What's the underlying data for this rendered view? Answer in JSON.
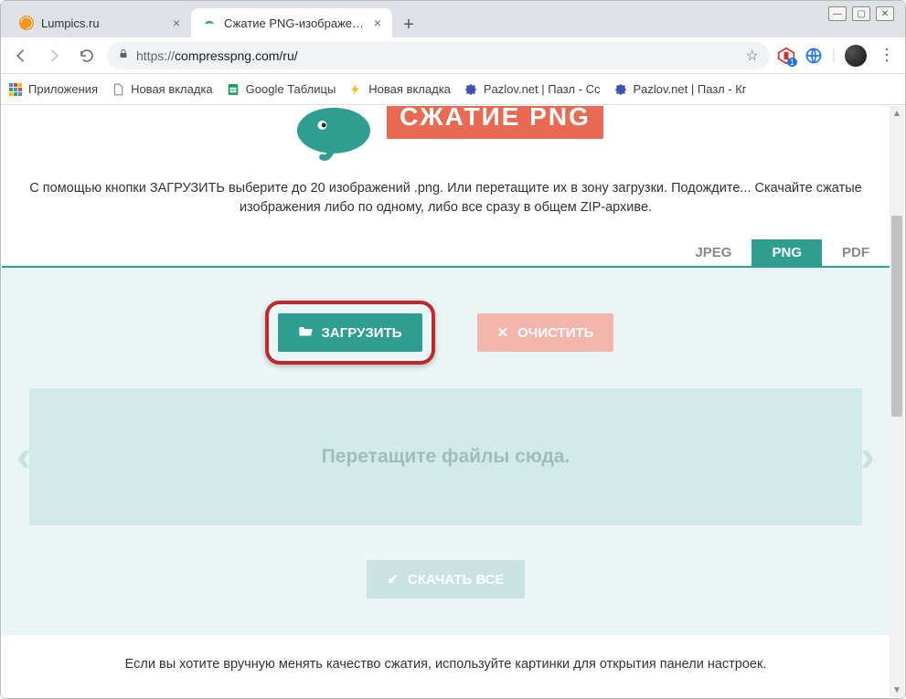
{
  "window_controls": {
    "min": "—",
    "max": "▢",
    "close": "✕"
  },
  "tabs": [
    {
      "title": "Lumpics.ru",
      "active": false,
      "favicon_color": "#f7931e"
    },
    {
      "title": "Сжатие PNG-изображений онл",
      "active": true,
      "favicon_color": "#2f9e91"
    }
  ],
  "address": {
    "protocol": "https://",
    "rest": "compresspng.com/ru/"
  },
  "ext_badge": "1",
  "bookmarks": [
    {
      "icon": "apps",
      "label": "Приложения"
    },
    {
      "icon": "doc",
      "label": "Новая вкладка"
    },
    {
      "icon": "sheets",
      "label": "Google Таблицы"
    },
    {
      "icon": "bolt",
      "label": "Новая вкладка"
    },
    {
      "icon": "puzzle",
      "label": "Pazlov.net | Пазл - Сс"
    },
    {
      "icon": "puzzle",
      "label": "Pazlov.net | Пазл - Кг"
    }
  ],
  "page": {
    "logo_text": "СЖАТИЕ PNG",
    "intro": "С помощью кнопки ЗАГРУЗИТЬ выберите до 20 изображений .png. Или перетащите их в зону загрузки. Подождите... Скачайте сжатые изображения либо по одному, либо все сразу в общем ZIP-архиве.",
    "format_tabs": [
      "JPEG",
      "PNG",
      "PDF"
    ],
    "active_format_index": 1,
    "upload_btn": "ЗАГРУЗИТЬ",
    "clear_btn": "ОЧИСТИТЬ",
    "dropzone_text": "Перетащите файлы сюда.",
    "download_btn": "СКАЧАТЬ ВСЕ",
    "hint": "Если вы хотите вручную менять качество сжатия, используйте картинки для открытия панели настроек."
  }
}
